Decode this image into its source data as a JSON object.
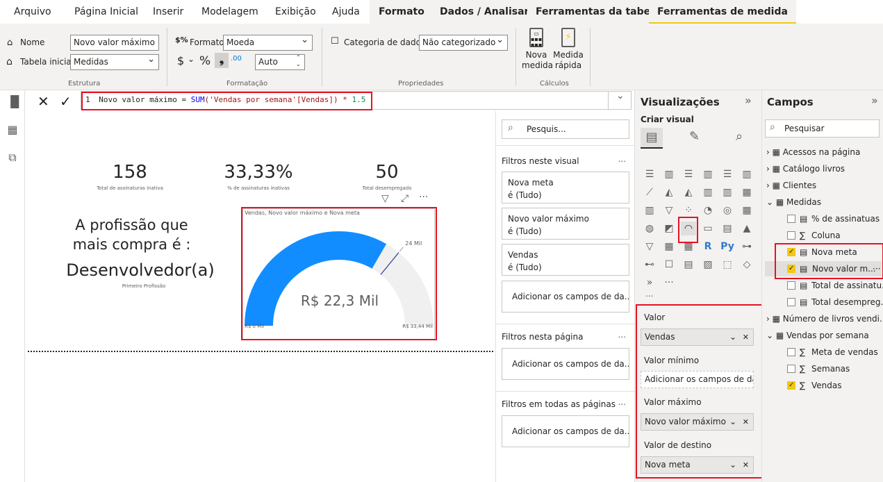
{
  "menu_tabs": [
    "Arquivo",
    "Página Inicial",
    "Inserir",
    "Modelagem",
    "Exibição",
    "Ajuda",
    "Formato",
    "Dados / Analisar",
    "Ferramentas da tabela",
    "Ferramentas de medida"
  ],
  "ribbon": {
    "name_label": "Nome",
    "name_value": "Novo valor máximo",
    "home_table_label": "Tabela inicial",
    "home_table_value": "Medidas",
    "group_structure": "Estrutura",
    "format_label": "Formato",
    "format_value": "Moeda",
    "currency_symbol": "$",
    "percent_symbol": "%",
    "comma_symbol": "❟",
    "decimal_symbol": ".00",
    "auto_value": "Auto",
    "group_formatting": "Formatação",
    "data_category_label": "Categoria de dados",
    "data_category_value": "Não categorizado",
    "group_properties": "Propriedades",
    "new_measure_label": "Nova medida",
    "quick_measure_label": "Medida rápida",
    "group_calculations": "Cálculos"
  },
  "formula_bar": {
    "line_number": "1",
    "text_part1": "Novo valor máximo = ",
    "text_func": "SUM",
    "text_part2": "('Vendas por semana'[Vendas]) * ",
    "text_num": "1.5"
  },
  "canvas": {
    "cards": [
      {
        "value": "158",
        "label": "Total de assinaturas inativa"
      },
      {
        "value": "33,33%",
        "label": "% de assinaturas inativas"
      },
      {
        "value": "50",
        "label": "Total desempregado"
      }
    ],
    "profession_heading": "A profissão que mais compra é :",
    "profession_value": "Desenvolvedor(a)",
    "profession_sublabel": "Primeiro Profissão",
    "gauge": {
      "title": "Vendas, Novo valor máximo e Nova meta",
      "value_label": "R$ 22,3 Mil",
      "min_label": "R$ 0 Mil",
      "max_label": "R$ 33,44 Mil",
      "target_label": "24 Mil",
      "value": 22.3,
      "min": 0,
      "max": 33.44,
      "target": 24,
      "fill_color": "#118dff",
      "track_color": "#f0f0f0"
    },
    "visual_header_icons": [
      "filter-icon",
      "focus-mode-icon",
      "more-options-icon"
    ]
  },
  "filters": {
    "search_placeholder": "Pesquis...",
    "section_visual": "Filtros neste visual",
    "visual_filters": [
      {
        "name": "Nova meta",
        "state": "é (Tudo)"
      },
      {
        "name": "Novo valor máximo",
        "state": "é (Tudo)"
      },
      {
        "name": "Vendas",
        "state": "é (Tudo)"
      }
    ],
    "add_fields": "Adicionar os campos de da...",
    "section_page": "Filtros nesta página",
    "section_all": "Filtros em todas as páginas",
    "more": "..."
  },
  "visualizations": {
    "title": "Visualizações",
    "collapse": "»",
    "build_visual": "Criar visual",
    "wells": [
      {
        "label": "Valor",
        "field": "Vendas",
        "empty": false
      },
      {
        "label": "Valor mínimo",
        "field": "Adicionar os campos de da...",
        "empty": true
      },
      {
        "label": "Valor máximo",
        "field": "Novo valor máximo",
        "empty": false
      },
      {
        "label": "Valor de destino",
        "field": "Nova meta",
        "empty": false
      }
    ],
    "more": "..."
  },
  "fields_pane": {
    "title": "Campos",
    "collapse": "»",
    "search_placeholder": "Pesquisar",
    "tables": [
      {
        "name": "Acessos na página",
        "expanded": false
      },
      {
        "name": "Catálogo livros",
        "expanded": false
      },
      {
        "name": "Clientes",
        "expanded": false
      },
      {
        "name": "Medidas",
        "expanded": true,
        "items": [
          {
            "name": "% de assinatuas i...",
            "checked": false,
            "kind": "measure"
          },
          {
            "name": "Coluna",
            "checked": false,
            "kind": "sum"
          },
          {
            "name": "Nova meta",
            "checked": true,
            "kind": "measure"
          },
          {
            "name": "Novo valor m...",
            "checked": true,
            "kind": "measure"
          },
          {
            "name": "Total de assinatu...",
            "checked": false,
            "kind": "measure"
          },
          {
            "name": "Total desempreg...",
            "checked": false,
            "kind": "measure"
          }
        ]
      },
      {
        "name": "Número de livros vendi...",
        "expanded": false
      },
      {
        "name": "Vendas por semana",
        "expanded": true,
        "items": [
          {
            "name": "Meta de vendas",
            "checked": false,
            "kind": "sum"
          },
          {
            "name": "Semanas",
            "checked": false,
            "kind": "sum"
          },
          {
            "name": "Vendas",
            "checked": true,
            "kind": "sum"
          }
        ]
      }
    ],
    "more": "···"
  }
}
